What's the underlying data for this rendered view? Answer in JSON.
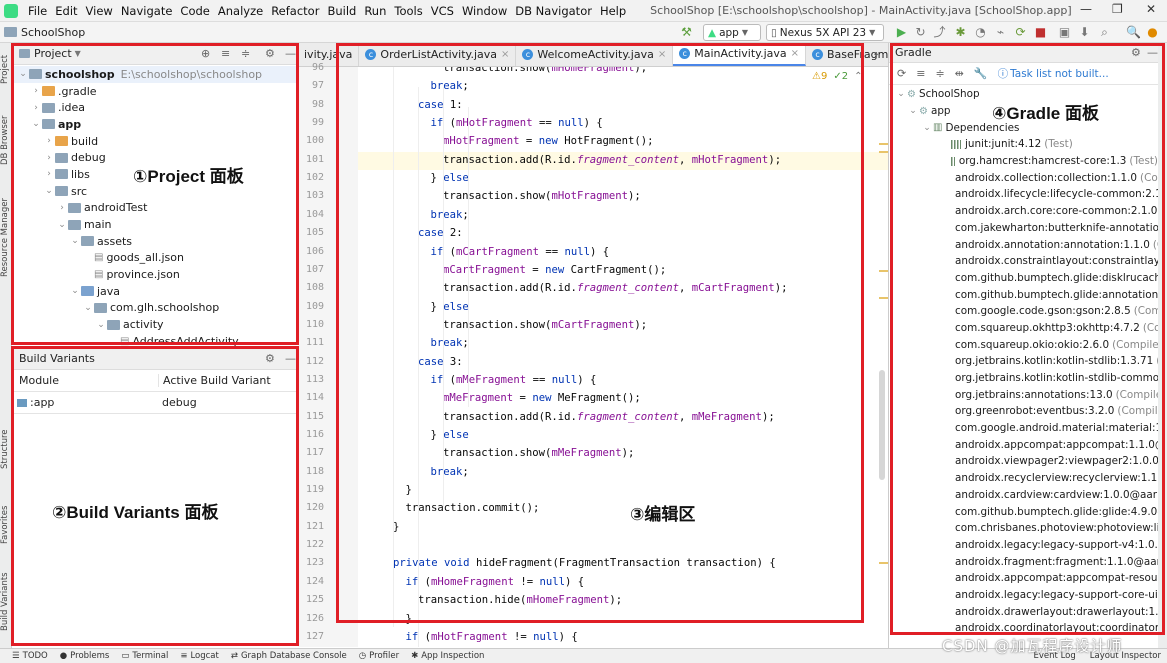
{
  "menubar": {
    "items": [
      "File",
      "Edit",
      "View",
      "Navigate",
      "Code",
      "Analyze",
      "Refactor",
      "Build",
      "Run",
      "Tools",
      "VCS",
      "Window",
      "DB Navigator",
      "Help"
    ],
    "window_title": "SchoolShop [E:\\schoolshop\\schoolshop] - MainActivity.java [SchoolShop.app]"
  },
  "navbar": {
    "project": "SchoolShop",
    "run_config": "app",
    "device": "Nexus 5X API 23"
  },
  "left_strip": {
    "tabs": [
      "Project",
      "DB Browser",
      "Resource Manager",
      "Structure",
      "Favorites",
      "Build Variants"
    ]
  },
  "project_panel": {
    "title": "Project",
    "tree": [
      {
        "label": "schoolshop",
        "extra": "E:\\schoolshop\\schoolshop",
        "depth": 0,
        "open": true,
        "bold": true
      },
      {
        "label": ".gradle",
        "depth": 1,
        "open": false,
        "folder": "orange"
      },
      {
        "label": ".idea",
        "depth": 1,
        "open": false
      },
      {
        "label": "app",
        "depth": 1,
        "open": true,
        "bold": true
      },
      {
        "label": "build",
        "depth": 2,
        "open": false,
        "folder": "orange"
      },
      {
        "label": "debug",
        "depth": 2,
        "open": false
      },
      {
        "label": "libs",
        "depth": 2,
        "open": false
      },
      {
        "label": "src",
        "depth": 2,
        "open": true
      },
      {
        "label": "androidTest",
        "depth": 3,
        "open": false
      },
      {
        "label": "main",
        "depth": 3,
        "open": true
      },
      {
        "label": "assets",
        "depth": 4,
        "open": true
      },
      {
        "label": "goods_all.json",
        "depth": 5,
        "file": true
      },
      {
        "label": "province.json",
        "depth": 5,
        "file": true
      },
      {
        "label": "java",
        "depth": 4,
        "open": true,
        "folder": "blue"
      },
      {
        "label": "com.glh.schoolshop",
        "depth": 5,
        "open": true
      },
      {
        "label": "activity",
        "depth": 6,
        "open": true
      },
      {
        "label": "AddressAddActivity",
        "depth": 7,
        "file": true
      }
    ]
  },
  "build_variants": {
    "title": "Build Variants",
    "col_module": "Module",
    "col_variant": "Active Build Variant",
    "rows": [
      {
        "module": ":app",
        "variant": "debug"
      }
    ]
  },
  "editor": {
    "tabs": [
      {
        "label": "ivity.java",
        "active": false
      },
      {
        "label": "OrderListActivity.java",
        "active": false
      },
      {
        "label": "WelcomeActivity.java",
        "active": false
      },
      {
        "label": "MainActivity.java",
        "active": true
      },
      {
        "label": "BaseFragment.java",
        "active": false
      }
    ],
    "warnings": "9",
    "weak": "2",
    "lines": [
      {
        "n": "96",
        "i": 6,
        "t": "transaction.show(mHomeFragment);"
      },
      {
        "n": "97",
        "i": 5,
        "t": "break;"
      },
      {
        "n": "98",
        "i": 4,
        "t": "case 1:"
      },
      {
        "n": "99",
        "i": 5,
        "t": "if (mHotFragment == null) {"
      },
      {
        "n": "100",
        "i": 6,
        "t": "mHotFragment = new HotFragment();"
      },
      {
        "n": "101",
        "i": 6,
        "t": "transaction.add(R.id.fragment_content, mHotFragment);"
      },
      {
        "n": "102",
        "i": 5,
        "t": "} else"
      },
      {
        "n": "103",
        "i": 6,
        "t": "transaction.show(mHotFragment);"
      },
      {
        "n": "104",
        "i": 5,
        "t": "break;"
      },
      {
        "n": "105",
        "i": 4,
        "t": "case 2:"
      },
      {
        "n": "106",
        "i": 5,
        "t": "if (mCartFragment == null) {"
      },
      {
        "n": "107",
        "i": 6,
        "t": "mCartFragment = new CartFragment();"
      },
      {
        "n": "108",
        "i": 6,
        "t": "transaction.add(R.id.fragment_content, mCartFragment);"
      },
      {
        "n": "109",
        "i": 5,
        "t": "} else"
      },
      {
        "n": "110",
        "i": 6,
        "t": "transaction.show(mCartFragment);"
      },
      {
        "n": "111",
        "i": 5,
        "t": "break;"
      },
      {
        "n": "112",
        "i": 4,
        "t": "case 3:"
      },
      {
        "n": "113",
        "i": 5,
        "t": "if (mMeFragment == null) {"
      },
      {
        "n": "114",
        "i": 6,
        "t": "mMeFragment = new MeFragment();"
      },
      {
        "n": "115",
        "i": 6,
        "t": "transaction.add(R.id.fragment_content, mMeFragment);"
      },
      {
        "n": "116",
        "i": 5,
        "t": "} else"
      },
      {
        "n": "117",
        "i": 6,
        "t": "transaction.show(mMeFragment);"
      },
      {
        "n": "118",
        "i": 5,
        "t": "break;"
      },
      {
        "n": "119",
        "i": 3,
        "t": "}"
      },
      {
        "n": "120",
        "i": 3,
        "t": "transaction.commit();"
      },
      {
        "n": "121",
        "i": 2,
        "t": "}"
      },
      {
        "n": "122",
        "i": 0,
        "t": ""
      },
      {
        "n": "123",
        "i": 2,
        "t": "private void hideFragment(FragmentTransaction transaction) {"
      },
      {
        "n": "124",
        "i": 3,
        "t": "if (mHomeFragment != null) {"
      },
      {
        "n": "125",
        "i": 4,
        "t": "transaction.hide(mHomeFragment);"
      },
      {
        "n": "126",
        "i": 3,
        "t": "}"
      },
      {
        "n": "127",
        "i": 3,
        "t": "if (mHotFragment != null) {"
      }
    ]
  },
  "gradle_panel": {
    "title": "Gradle",
    "task_msg": "Task list not built...",
    "root": "SchoolShop",
    "module": "app",
    "deps_label": "Dependencies",
    "deps": [
      {
        "name": "junit:junit:4.12",
        "scope": "(Test)"
      },
      {
        "name": "org.hamcrest:hamcrest-core:1.3",
        "scope": "(Test)"
      },
      {
        "name": "androidx.collection:collection:1.1.0",
        "scope": "(Compile"
      },
      {
        "name": "androidx.lifecycle:lifecycle-common:2.1.0",
        "scope": "(C"
      },
      {
        "name": "androidx.arch.core:core-common:2.1.0",
        "scope": "(Con"
      },
      {
        "name": "com.jakewharton:butterknife-annotations:",
        "scope": ""
      },
      {
        "name": "androidx.annotation:annotation:1.1.0",
        "scope": "(Com"
      },
      {
        "name": "androidx.constraintlayout:constraintlayout-",
        "scope": ""
      },
      {
        "name": "com.github.bumptech.glide:disklrucache:4.",
        "scope": ""
      },
      {
        "name": "com.github.bumptech.glide:annotations:4.9",
        "scope": ""
      },
      {
        "name": "com.google.code.gson:gson:2.8.5",
        "scope": "(Compile"
      },
      {
        "name": "com.squareup.okhttp3:okhttp:4.7.2",
        "scope": "(Compi"
      },
      {
        "name": "com.squareup.okio:okio:2.6.0",
        "scope": "(Compile)"
      },
      {
        "name": "org.jetbrains.kotlin:kotlin-stdlib:1.3.71",
        "scope": "(Con"
      },
      {
        "name": "org.jetbrains.kotlin:kotlin-stdlib-common:1",
        "scope": ""
      },
      {
        "name": "org.jetbrains:annotations:13.0",
        "scope": "(Compile)"
      },
      {
        "name": "org.greenrobot:eventbus:3.2.0",
        "scope": "(Compile)"
      },
      {
        "name": "com.google.android.material:material:1.1.0",
        "scope": ""
      },
      {
        "name": "androidx.appcompat:appcompat:1.1.0@aar",
        "scope": ""
      },
      {
        "name": "androidx.viewpager2:viewpager2:1.0.0@aar",
        "scope": ""
      },
      {
        "name": "androidx.recyclerview:recyclerview:1.1.0@",
        "scope": ""
      },
      {
        "name": "androidx.cardview:cardview:1.0.0@aar",
        "scope": "(Cor"
      },
      {
        "name": "com.github.bumptech.glide:glide:4.9.0@aa",
        "scope": ""
      },
      {
        "name": "com.chrisbanes.photoview:photoview:library:1.2",
        "scope": ""
      },
      {
        "name": "androidx.legacy:legacy-support-v4:1.0.0@a",
        "scope": ""
      },
      {
        "name": "androidx.fragment:fragment:1.1.0@aar",
        "scope": "(Co"
      },
      {
        "name": "androidx.appcompat:appcompat-resources:",
        "scope": ""
      },
      {
        "name": "androidx.legacy:legacy-support-core-ui:1.0",
        "scope": ""
      },
      {
        "name": "androidx.drawerlayout:drawerlayout:1.0.0@",
        "scope": ""
      },
      {
        "name": "androidx.coordinatorlayout:coordinatorlayo",
        "scope": ""
      }
    ]
  },
  "statusbar": {
    "items": [
      "TODO",
      "Problems",
      "Terminal",
      "Logcat",
      "Graph Database Console",
      "Profiler",
      "App Inspection"
    ],
    "right_items": [
      "Event Log",
      "Layout Inspector"
    ]
  },
  "annotations": {
    "project": "①Project 面板",
    "build_variants": "②Build Variants 面板",
    "editor": "③编辑区",
    "gradle": "④Gradle 面板"
  },
  "watermark": "CSDN @加瓦程序设计师",
  "colors": {
    "annotation_red": "#e01e26",
    "keyword": "#0033b3",
    "field": "#871094"
  }
}
